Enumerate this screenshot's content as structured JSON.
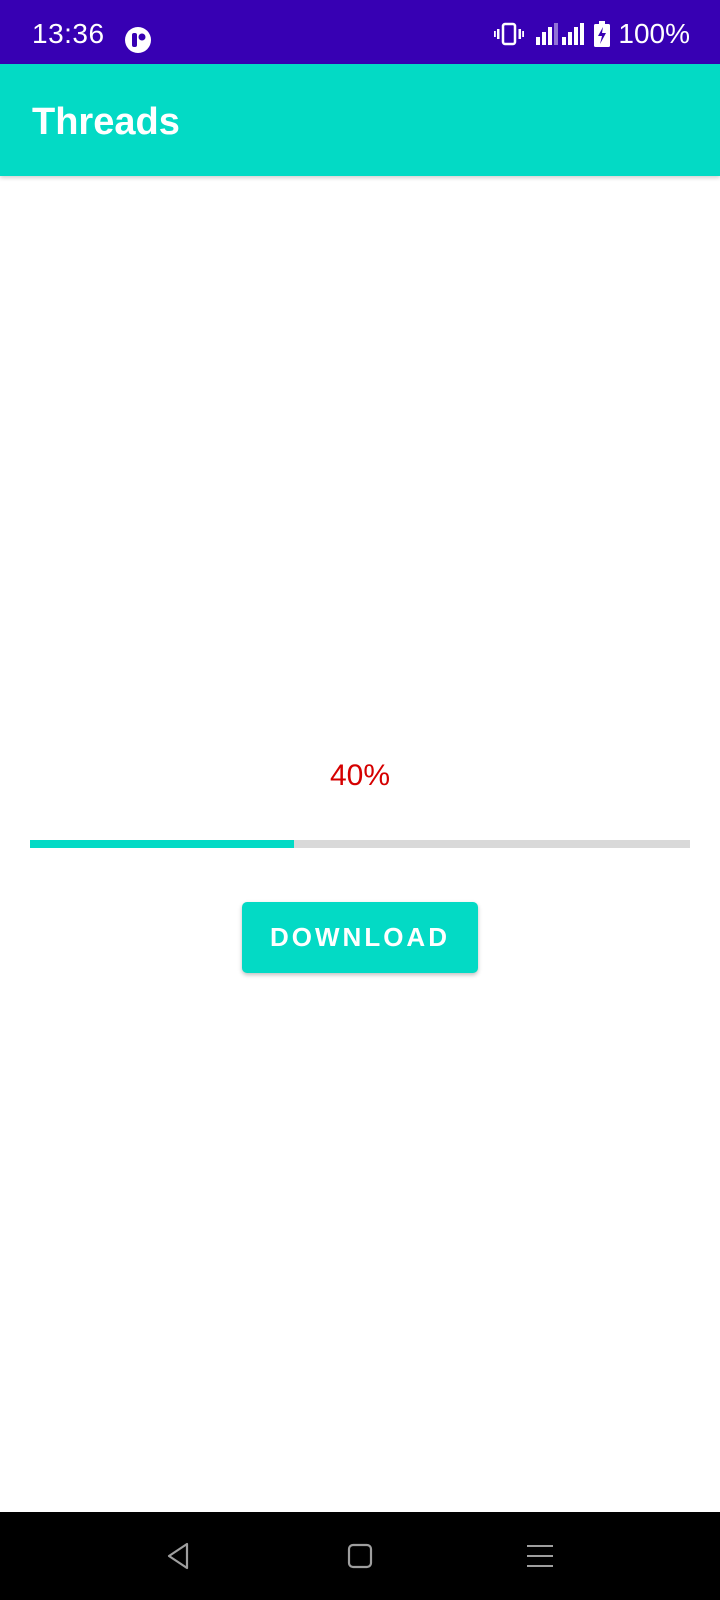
{
  "status_bar": {
    "time": "13:36",
    "battery_text": "100%",
    "background": "#3700b3",
    "icons": [
      "app-notification-icon",
      "vibrate-icon",
      "signal-icon",
      "signal-icon",
      "battery-charging-icon"
    ]
  },
  "app_bar": {
    "title": "Threads",
    "background": "#03dac5"
  },
  "main": {
    "progress_label": "40%",
    "progress_value": 0.4,
    "progress_label_color": "#d50000",
    "download_label": "DOWNLOAD"
  },
  "nav_bar": {
    "icons": [
      "back-icon",
      "home-icon",
      "menu-icon"
    ]
  }
}
